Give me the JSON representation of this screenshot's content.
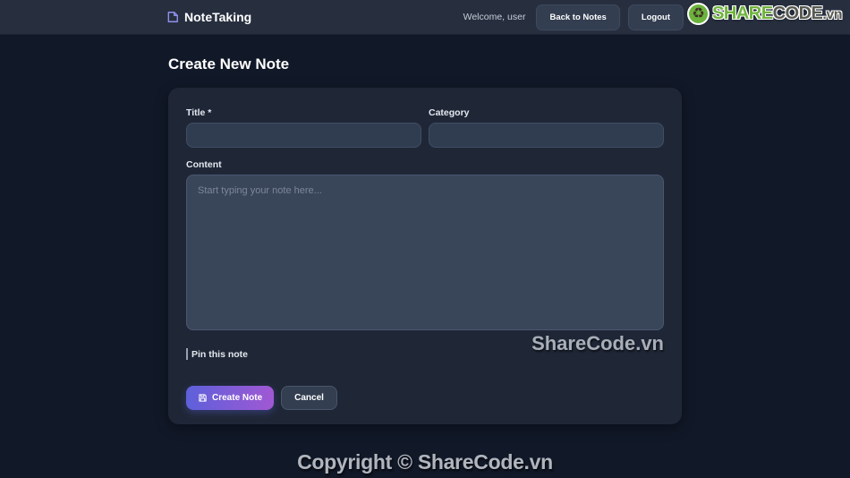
{
  "navbar": {
    "brand": "NoteTaking",
    "welcome_text": "Welcome, user",
    "back_button": "Back to Notes",
    "logout_button": "Logout"
  },
  "logo": {
    "icon_glyph": "♻",
    "share": "SHARE",
    "code": "CODE",
    "vn": ".vn"
  },
  "page": {
    "heading": "Create New Note"
  },
  "form": {
    "title_label": "Title *",
    "title_value": "",
    "category_label": "Category",
    "category_value": "",
    "content_label": "Content",
    "content_placeholder": "Start typing your note here...",
    "content_value": "",
    "pin_label": "Pin this note",
    "pin_checked": false,
    "create_button": "Create Note",
    "cancel_button": "Cancel"
  },
  "watermark": "ShareCode.vn",
  "footer": {
    "copyright": "Copyright © ShareCode.vn"
  },
  "colors": {
    "page_bg": "#111827",
    "navbar_bg": "#272f3f",
    "card_bg": "#1f2737",
    "input_bg": "#303c50",
    "textarea_bg": "#394559",
    "accent_gradient_start": "#5d60da",
    "accent_gradient_end": "#a158d4",
    "brand_icon_purple": "#8d90ea",
    "logo_green": "#6fb33c",
    "muted_text": "#b0b5be"
  }
}
